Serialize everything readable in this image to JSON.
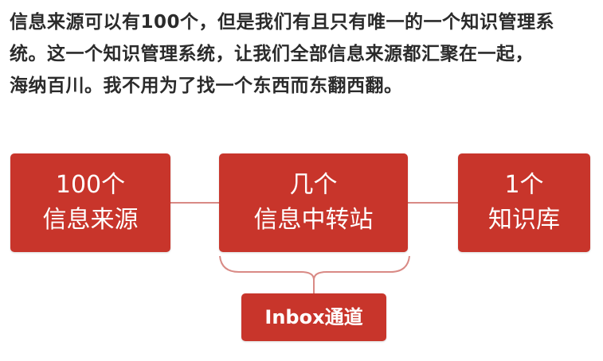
{
  "paragraph": {
    "line1": "信息来源可以有100个，但是我们有且只有唯一的一个知识管理系",
    "line2": "统。这一个知识管理系统，让我们全部信息来源都汇聚在一起，",
    "line3": "海纳百川。我不用为了找一个东西而东翻西翻。"
  },
  "diagram": {
    "sources": {
      "line1": "100个",
      "line2": "信息来源"
    },
    "transfer": {
      "line1": "几个",
      "line2": "信息中转站"
    },
    "knowledge_base": {
      "line1": "1个",
      "line2": "知识库"
    },
    "inbox": {
      "label": "Inbox通道"
    }
  },
  "colors": {
    "box_fill": "#c8352b",
    "connector": "#d98a85",
    "text_dark": "#2b2b2b"
  }
}
